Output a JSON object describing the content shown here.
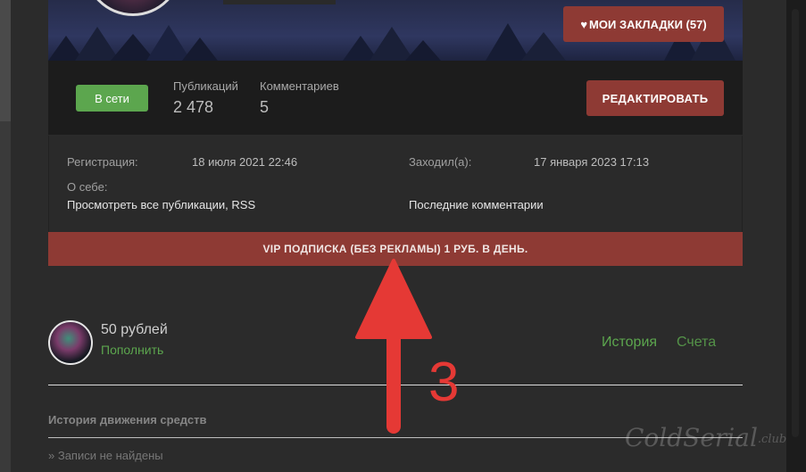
{
  "header": {
    "bookmarks_label": "МОИ ЗАКЛАДКИ (57)",
    "heart_icon": "heart-icon"
  },
  "profile": {
    "status": "В сети",
    "publications_label": "Публикаций",
    "publications_value": "2 478",
    "comments_label": "Комментариев",
    "comments_value": "5",
    "edit_label": "РЕДАКТИРОВАТЬ"
  },
  "info": {
    "registration_label": "Регистрация:",
    "registration_value": "18 июля 2021 22:46",
    "last_visit_label": "Заходил(а):",
    "last_visit_value": "17 января 2023 17:13",
    "about_label": "О себе:",
    "all_publications_link": "Просмотреть все публикации, RSS",
    "last_comments_link": "Последние комментарии"
  },
  "vip": {
    "label": "VIP ПОДПИСКА (БЕЗ РЕКЛАМЫ) 1 РУБ. В ДЕНЬ."
  },
  "wallet": {
    "balance": "50 рублей",
    "topup": "Пополнить",
    "tab_history": "История",
    "tab_accounts": "Счета",
    "section_title": "История движения средств",
    "empty_text": "» Записи не найдены"
  },
  "annotation": {
    "step_number": "3",
    "color": "#e53935"
  },
  "watermark": {
    "text": "ColdSerial",
    "suffix": ".club"
  },
  "colors": {
    "accent_red": "#8e3a34",
    "online_green": "#5ca64e",
    "background": "#2b2b2b"
  }
}
